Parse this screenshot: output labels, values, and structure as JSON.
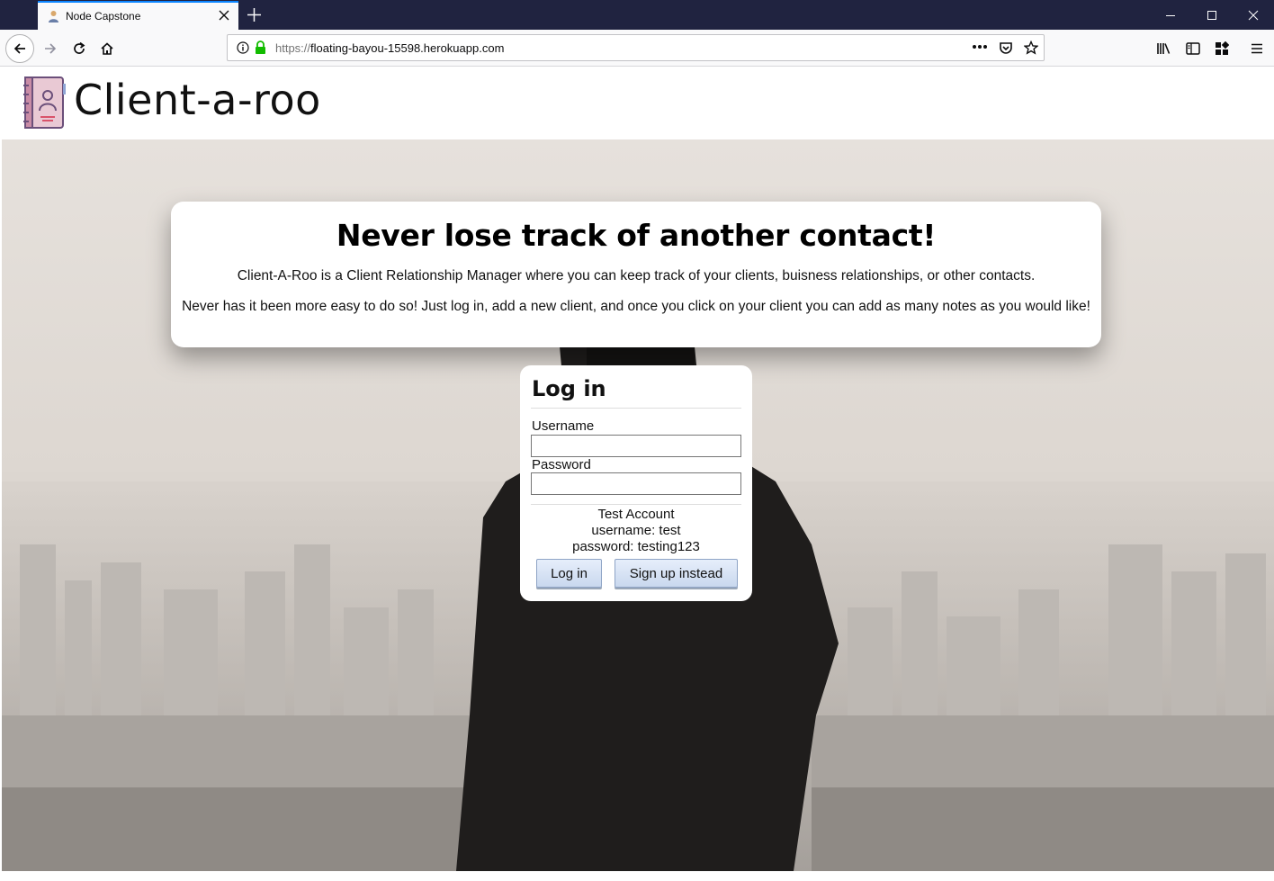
{
  "browser": {
    "tab_title": "Node Capstone",
    "url_protocol": "https://",
    "url_host": "floating-bayou-15598.herokuapp.com"
  },
  "site": {
    "title": "Client-a-roo"
  },
  "intro": {
    "heading": "Never lose track of another contact!",
    "paragraph1": "Client-A-Roo is a Client Relationship Manager where you can keep track of your clients, buisness relationships, or other contacts.",
    "paragraph2": "Never has it been more easy to do so! Just log in, add a new client, and once you click on your client you can add as many notes as you would like!"
  },
  "login": {
    "heading": "Log in",
    "username_label": "Username",
    "username_value": "",
    "password_label": "Password",
    "password_value": "",
    "test_account_title": "Test Account",
    "test_username": "username: test",
    "test_password": "password: testing123",
    "login_button": "Log in",
    "signup_button": "Sign up instead"
  },
  "colors": {
    "tabbar": "#202340",
    "tab_accent": "#0a84ff",
    "button_face": "#c9d8ee"
  }
}
